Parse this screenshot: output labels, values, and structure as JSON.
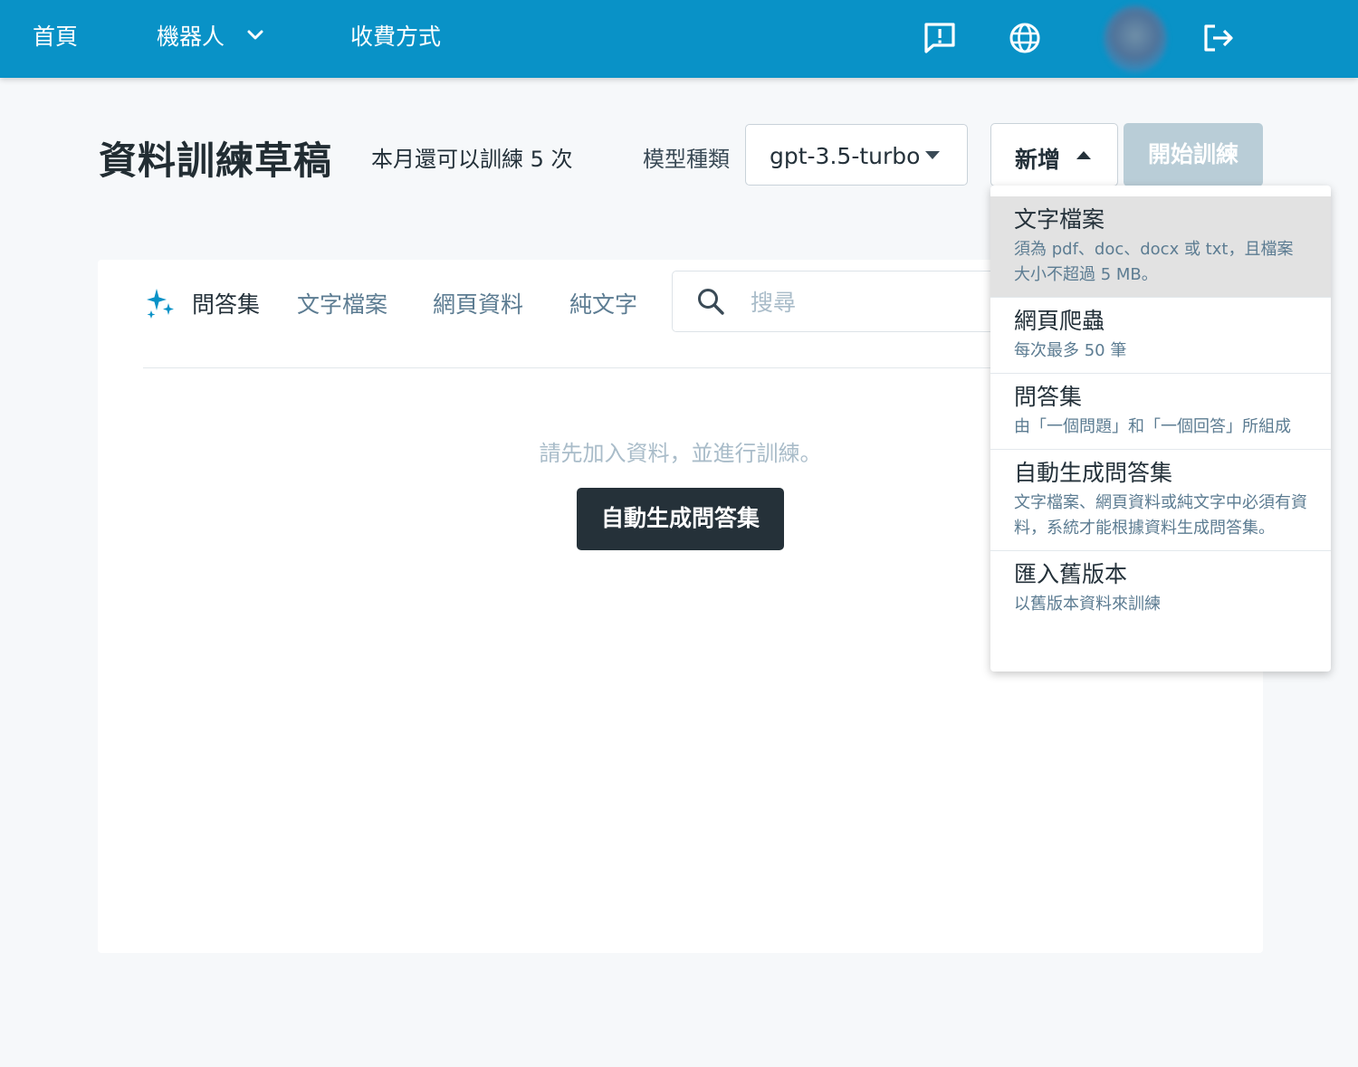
{
  "nav": {
    "home": "首頁",
    "bots": "機器人",
    "pricing": "收費方式",
    "icons": [
      "chevron-down-icon",
      "feedback-icon",
      "globe-icon",
      "avatar",
      "logout-icon"
    ]
  },
  "header": {
    "title": "資料訓練草稿",
    "quota": "本月還可以訓練 5 次",
    "model_label": "模型種類",
    "model_value": "gpt-3.5-turbo",
    "add_label": "新增",
    "train_label": "開始訓練"
  },
  "tabs": [
    {
      "label": "問答集",
      "active": true
    },
    {
      "label": "文字檔案",
      "active": false
    },
    {
      "label": "網頁資料",
      "active": false
    },
    {
      "label": "純文字",
      "active": false
    }
  ],
  "search": {
    "placeholder": "搜尋"
  },
  "empty": {
    "message": "請先加入資料，並進行訓練。",
    "auto_button": "自動生成問答集"
  },
  "menu": [
    {
      "title": "文字檔案",
      "desc": "須為 pdf、doc、docx 或 txt，且檔案大小不超過 5 MB。"
    },
    {
      "title": "網頁爬蟲",
      "desc": "每次最多 50 筆"
    },
    {
      "title": "問答集",
      "desc": "由「一個問題」和「一個回答」所組成"
    },
    {
      "title": "自動生成問答集",
      "desc": "文字檔案、網頁資料或純文字中必須有資料，系統才能根據資料生成問答集。"
    },
    {
      "title": "匯入舊版本",
      "desc": "以舊版本資料來訓練"
    }
  ],
  "colors": {
    "nav_bg": "#0992c7",
    "primary_dark": "#253139",
    "disabled_btn": "#b9cdd7",
    "muted_text": "#a9bcc9",
    "tab_text": "#5c7c92",
    "sparkle": "#0992c7"
  }
}
